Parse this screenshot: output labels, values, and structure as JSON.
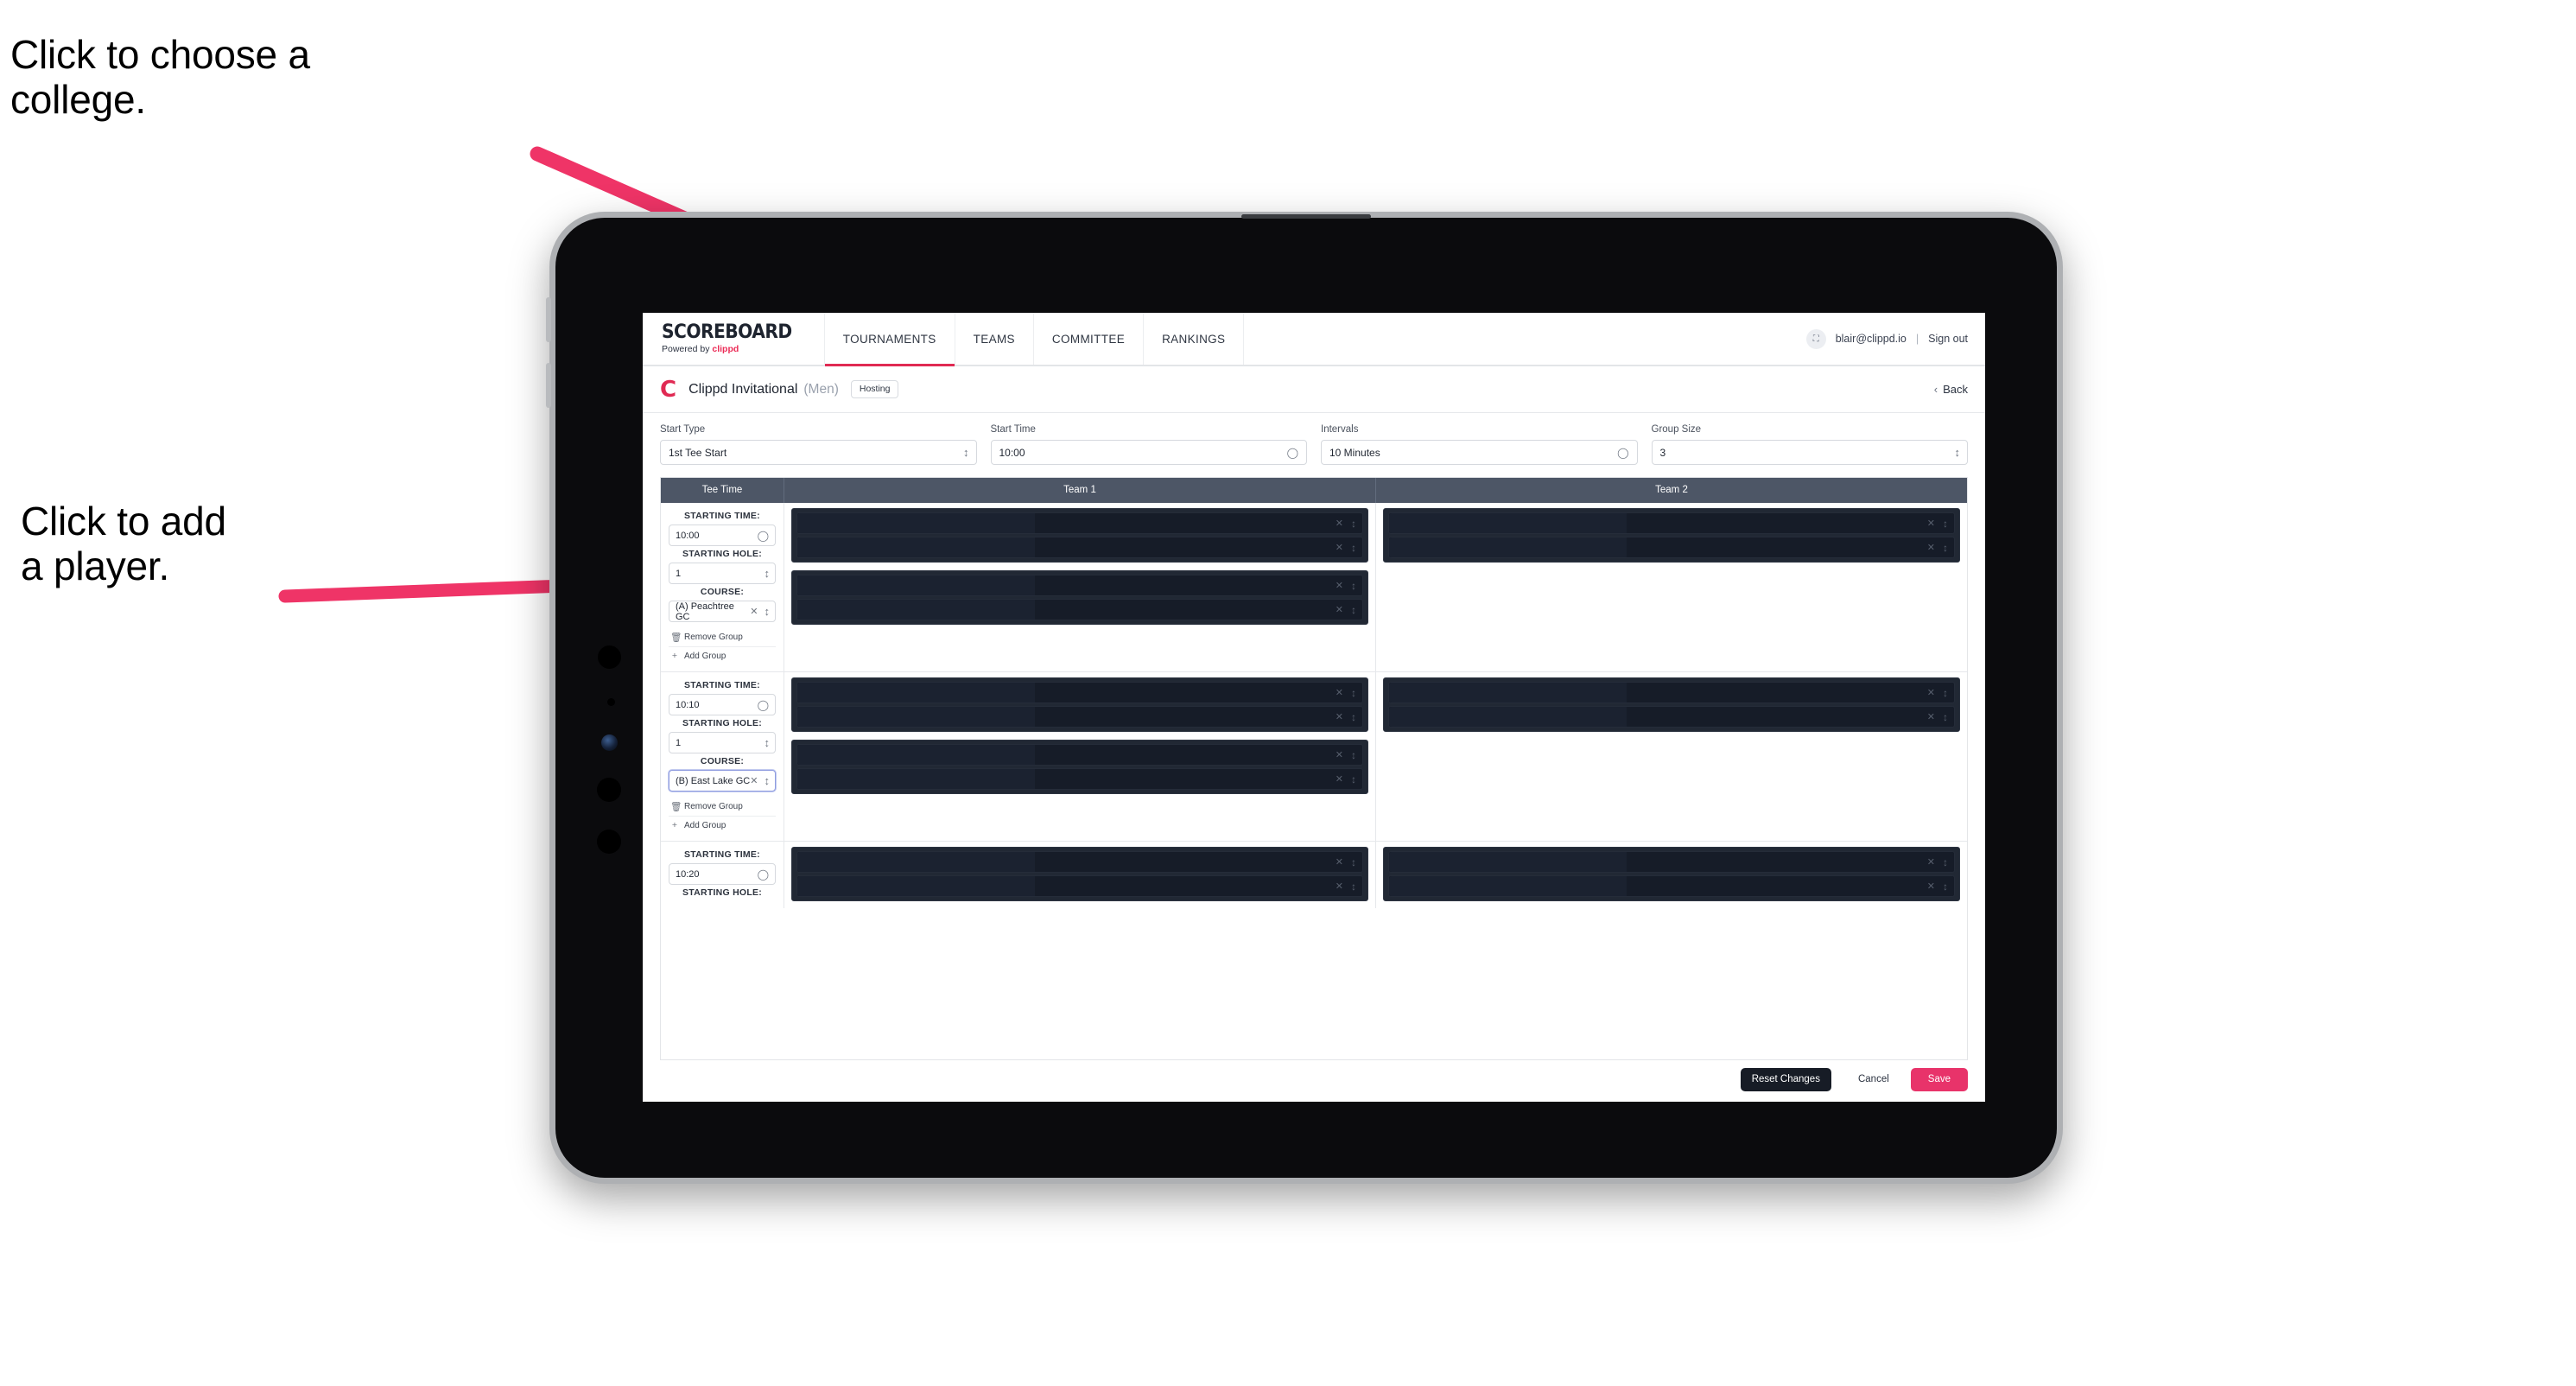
{
  "annotations": {
    "college": "Click to choose a\ncollege.",
    "player": "Click to add\na player.",
    "arrow_color": "#ef3467"
  },
  "device": {
    "type": "tablet"
  },
  "topnav": {
    "brand_title": "SCOREBOARD",
    "brand_sub_prefix": "Powered by ",
    "brand_sub_brand": "clippd",
    "tabs": [
      {
        "label": "TOURNAMENTS",
        "active": true
      },
      {
        "label": "TEAMS",
        "active": false
      },
      {
        "label": "COMMITTEE",
        "active": false
      },
      {
        "label": "RANKINGS",
        "active": false
      }
    ],
    "avatar_icon": "user-icon",
    "email": "blair@clippd.io",
    "separator": "|",
    "signout": "Sign out"
  },
  "tournament_bar": {
    "logo_letter": "C",
    "name": "Clippd Invitational",
    "gender": "(Men)",
    "badge": "Hosting",
    "back_chevron": "‹",
    "back_label": "Back"
  },
  "settings": {
    "start_type": {
      "label": "Start Type",
      "value": "1st Tee Start",
      "icon": "stepper-icon"
    },
    "start_time": {
      "label": "Start Time",
      "value": "10:00",
      "icon": "clock-icon"
    },
    "intervals": {
      "label": "Intervals",
      "value": "10 Minutes",
      "icon": "clock-icon"
    },
    "group_size": {
      "label": "Group Size",
      "value": "3",
      "icon": "stepper-icon"
    }
  },
  "table": {
    "headers": {
      "tee_time": "Tee Time",
      "team1": "Team 1",
      "team2": "Team 2"
    },
    "labels": {
      "starting_time": "STARTING TIME:",
      "starting_hole": "STARTING HOLE:",
      "course": "COURSE:",
      "remove_group": "Remove Group",
      "add_group": "Add Group",
      "remove_icon": "trash-icon",
      "add_icon": "plus-icon",
      "clock_icon": "clock-icon",
      "stepper_icon": "stepper-icon",
      "clear_icon": "close-icon"
    },
    "rows": [
      {
        "starting_time": "10:00",
        "starting_hole": "1",
        "course": "(A) Peachtree GC",
        "course_focused": false,
        "team1_groups": [
          {
            "players": 2
          },
          {
            "players": 2
          }
        ],
        "team2_groups": [
          {
            "players": 2
          }
        ]
      },
      {
        "starting_time": "10:10",
        "starting_hole": "1",
        "course": "(B) East Lake GC",
        "course_focused": true,
        "team1_groups": [
          {
            "players": 2
          },
          {
            "players": 2
          }
        ],
        "team2_groups": [
          {
            "players": 2
          }
        ]
      },
      {
        "starting_time": "10:20",
        "starting_hole": "",
        "course": "",
        "course_focused": false,
        "team1_groups": [
          {
            "players": 2
          }
        ],
        "team2_groups": [
          {
            "players": 2
          }
        ]
      }
    ]
  },
  "footer": {
    "reset": "Reset Changes",
    "cancel": "Cancel",
    "save": "Save",
    "save_color": "#e8336a"
  }
}
